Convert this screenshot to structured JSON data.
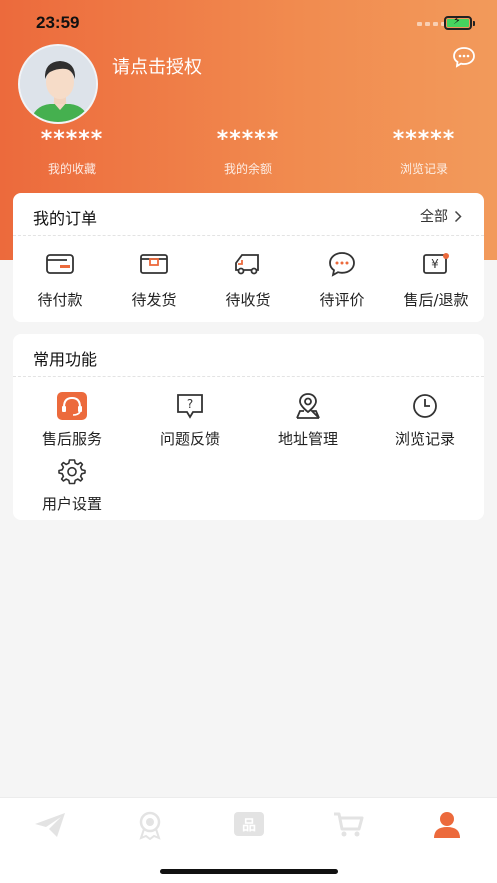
{
  "status_bar": {
    "time": "23:59"
  },
  "profile": {
    "auth_prompt": "请点击授权"
  },
  "stats": [
    {
      "value": "*****",
      "label": "我的收藏"
    },
    {
      "value": "*****",
      "label": "我的余额"
    },
    {
      "value": "*****",
      "label": "浏览记录"
    }
  ],
  "orders": {
    "title": "我的订单",
    "more_label": "全部",
    "items": [
      {
        "label": "待付款",
        "icon": "wallet-icon"
      },
      {
        "label": "待发货",
        "icon": "package-icon"
      },
      {
        "label": "待收货",
        "icon": "truck-icon"
      },
      {
        "label": "待评价",
        "icon": "comment-icon"
      },
      {
        "label": "售后/退款",
        "icon": "refund-icon"
      }
    ]
  },
  "functions": {
    "title": "常用功能",
    "items": [
      {
        "label": "售后服务",
        "icon": "customer-service-icon"
      },
      {
        "label": "问题反馈",
        "icon": "feedback-icon"
      },
      {
        "label": "地址管理",
        "icon": "location-icon"
      },
      {
        "label": "浏览记录",
        "icon": "clock-icon"
      },
      {
        "label": "用户设置",
        "icon": "gear-icon"
      }
    ]
  },
  "tabbar": {
    "items": [
      {
        "icon": "send-icon"
      },
      {
        "icon": "award-icon"
      },
      {
        "icon": "products-icon"
      },
      {
        "icon": "cart-icon"
      },
      {
        "icon": "user-icon",
        "active": true
      }
    ]
  },
  "colors": {
    "accent": "#ec6a3c",
    "tab_active": "#ec6a3c",
    "tab_inactive": "#e3e3e3"
  }
}
